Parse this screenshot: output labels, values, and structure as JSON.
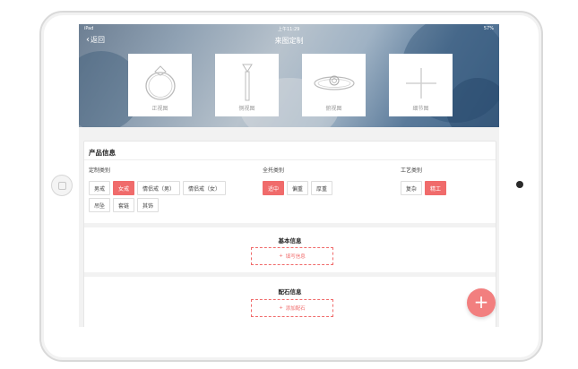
{
  "statusbar": {
    "carrier": "iPad",
    "time": "上午11:29",
    "battery": "57%"
  },
  "nav": {
    "back_label": "返回",
    "title": "来图定制"
  },
  "views": [
    {
      "label": "正视图",
      "icon": "ring-front-icon"
    },
    {
      "label": "侧视图",
      "icon": "ring-side-icon"
    },
    {
      "label": "俯视图",
      "icon": "ring-top-icon"
    },
    {
      "label": "细节图",
      "icon": "plus-icon"
    }
  ],
  "product_info": {
    "title": "产品信息",
    "custom_category": {
      "label": "定制类别",
      "options": [
        "男戒",
        "女戒",
        "情侣戒（男）",
        "情侣戒（女）",
        "吊坠",
        "套链",
        "其饰"
      ],
      "selected": "女戒"
    },
    "setting_category": {
      "label": "全托类别",
      "options": [
        "适中",
        "偏重",
        "厚重"
      ],
      "selected": "适中"
    },
    "craft_category": {
      "label": "工艺类别",
      "options": [
        "复杂",
        "精工"
      ],
      "selected": "精工"
    }
  },
  "basic_info": {
    "title": "基本信息",
    "button_label": "填写信息"
  },
  "stone_info": {
    "title": "配石信息",
    "button_label": "添加配石"
  },
  "fab": {
    "label": "+"
  },
  "colors": {
    "accent": "#f06b6b",
    "fab": "#f27f7f"
  }
}
